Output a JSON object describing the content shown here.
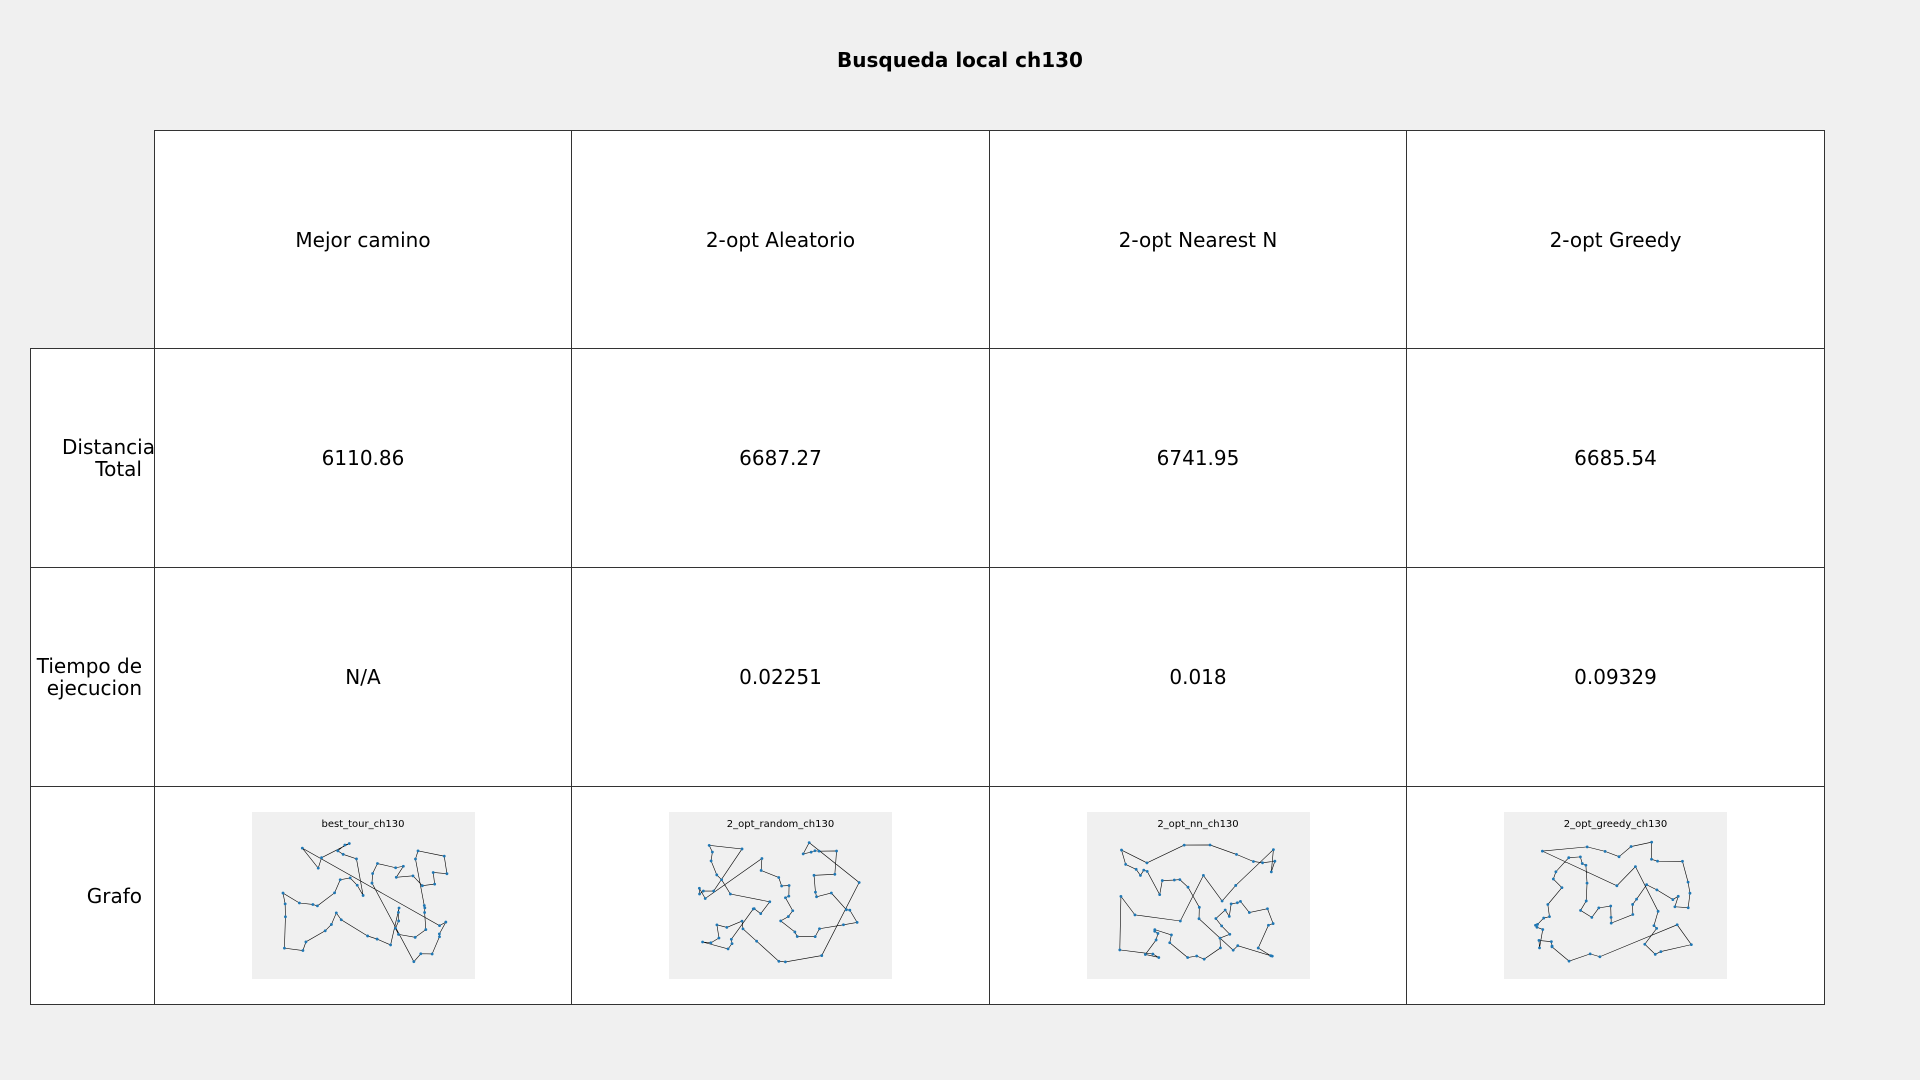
{
  "title": "Busqueda local ch130",
  "columns": [
    "Mejor camino",
    "2-opt Aleatorio",
    "2-opt Nearest N",
    "2-opt Greedy"
  ],
  "rows": [
    {
      "label": "Distancia Total",
      "values": [
        "6110.86",
        "6687.27",
        "6741.95",
        "6685.54"
      ]
    },
    {
      "label": "Tiempo de ejecucion",
      "values": [
        "N/A",
        "0.02251",
        "0.018",
        "0.09329"
      ]
    },
    {
      "label": "Grafo",
      "images": [
        "best_tour_ch130",
        "2_opt_random_ch130",
        "2_opt_nn_ch130",
        "2_opt_greedy_ch130"
      ]
    }
  ],
  "colors": {
    "node": "#1f77b4",
    "edge": "#000000",
    "background": "#f0f0f0",
    "cell": "#ffffff",
    "border": "#333333"
  }
}
